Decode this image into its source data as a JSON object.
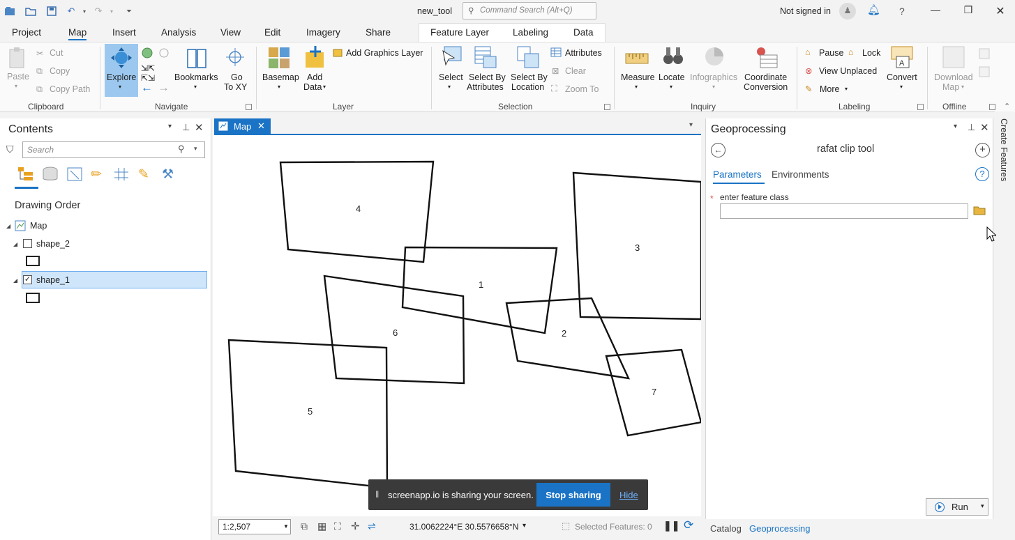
{
  "window": {
    "title": "new_tool",
    "search_placeholder": "Command Search (Alt+Q)",
    "signin": "Not signed in",
    "help": "?"
  },
  "tabs": [
    "Project",
    "Map",
    "Insert",
    "Analysis",
    "View",
    "Edit",
    "Imagery",
    "Share",
    "Feature Layer",
    "Labeling",
    "Data"
  ],
  "ribbon": {
    "clipboard": {
      "paste": "Paste",
      "cut": "Cut",
      "copy": "Copy",
      "copy_path": "Copy Path",
      "group": "Clipboard"
    },
    "navigate": {
      "explore": "Explore",
      "bookmarks": "Bookmarks",
      "goto_1": "Go",
      "goto_2": "To XY",
      "group": "Navigate"
    },
    "layer": {
      "basemap": "Basemap",
      "add_data_1": "Add",
      "add_data_2": "Data",
      "add_graphics": "Add Graphics Layer",
      "group": "Layer"
    },
    "selection": {
      "select": "Select",
      "sba_1": "Select By",
      "sba_2": "Attributes",
      "sbl_1": "Select By",
      "sbl_2": "Location",
      "attributes": "Attributes",
      "clear": "Clear",
      "zoom_to": "Zoom To",
      "group": "Selection"
    },
    "inquiry": {
      "measure": "Measure",
      "locate": "Locate",
      "infographics": "Infographics",
      "cc_1": "Coordinate",
      "cc_2": "Conversion",
      "group": "Inquiry"
    },
    "labeling": {
      "pause": "Pause",
      "lock": "Lock",
      "view_unplaced": "View Unplaced",
      "more": "More",
      "convert": "Convert",
      "group": "Labeling"
    },
    "offline": {
      "download_1": "Download",
      "download_2": "Map",
      "group": "Offline"
    }
  },
  "contents": {
    "title": "Contents",
    "search_placeholder": "Search",
    "drawing_order": "Drawing Order",
    "map": "Map",
    "layers": [
      {
        "name": "shape_2",
        "checked": false
      },
      {
        "name": "shape_1",
        "checked": true
      }
    ]
  },
  "map": {
    "tab": "Map",
    "labels": [
      "4",
      "3",
      "1",
      "6",
      "2",
      "7",
      "5"
    ],
    "scale": "1:2,507",
    "coords": "31.0062224°E 30.5576658°N",
    "selected_features": "Selected Features: 0"
  },
  "share": {
    "text": "screenapp.io is sharing your screen.",
    "stop": "Stop sharing",
    "hide": "Hide"
  },
  "geo": {
    "title": "Geoprocessing",
    "tool": "rafat clip tool",
    "tab_params": "Parameters",
    "tab_env": "Environments",
    "field_label": "enter feature class",
    "run": "Run",
    "bottom_tabs": [
      "Catalog",
      "Geoprocessing"
    ],
    "side_label": "Create Features"
  },
  "colors": {
    "accent": "#1a73c5"
  }
}
